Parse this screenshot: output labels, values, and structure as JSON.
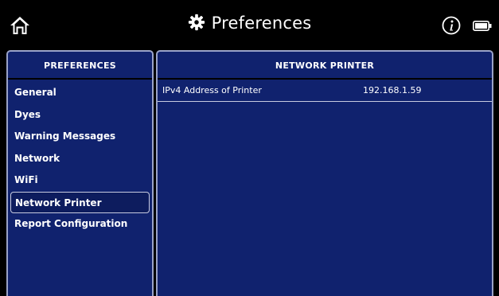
{
  "header": {
    "title": "Preferences",
    "icons": [
      "home-icon",
      "gear-icon",
      "info-icon",
      "battery-icon"
    ]
  },
  "sidebar": {
    "header": "PREFERENCES",
    "items": [
      {
        "label": "General"
      },
      {
        "label": "Dyes"
      },
      {
        "label": "Warning Messages"
      },
      {
        "label": "Network"
      },
      {
        "label": "WiFi"
      },
      {
        "label": "Network Printer",
        "selected": true
      },
      {
        "label": "Report Configuration"
      }
    ]
  },
  "main": {
    "header": "NETWORK PRINTER",
    "rows": [
      {
        "label": "IPv4 Address of Printer",
        "value": "192.168.1.59"
      }
    ]
  },
  "colors": {
    "panel_bg": "#10226e",
    "border": "#9aa3c8",
    "background": "#000000",
    "text": "#ffffff"
  }
}
